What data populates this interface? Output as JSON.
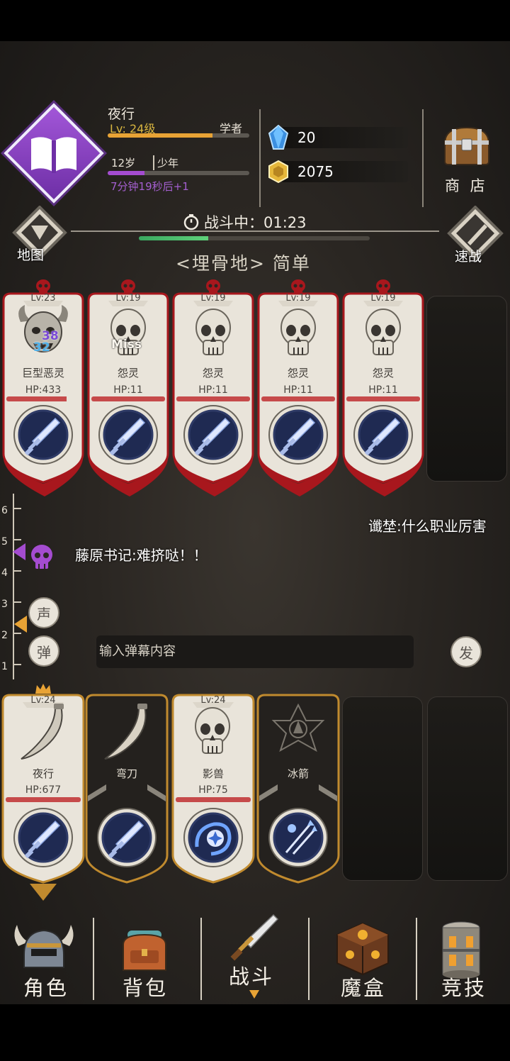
{
  "character": {
    "name": "夜行",
    "level": "Lv: 24级",
    "job": "学者",
    "xp_progress": 0.74,
    "age": "12岁",
    "stage": "少年",
    "age_progress": 0.26,
    "age_timer": "7分钟19秒后+1",
    "class_icon": "book-icon"
  },
  "currency": {
    "gems": "20",
    "coins": "2075",
    "shop_label": "商 店"
  },
  "header": {
    "map_label": "地图",
    "quick_battle_label": "速战",
    "battle_status": "战斗中：01:23",
    "battle_progress": 0.3,
    "location": "<埋骨地> 简单"
  },
  "enemies": [
    {
      "level": "Lv:23",
      "name": "巨型恶灵",
      "hp": "HP:433",
      "hp_ratio": 0.82,
      "dmg1": "38",
      "dmg2": "32",
      "skill": "sword-icon"
    },
    {
      "level": "Lv:19",
      "name": "怨灵",
      "hp": "HP:11",
      "hp_ratio": 1.0,
      "status": "Miss",
      "skill": "sword-icon"
    },
    {
      "level": "Lv:19",
      "name": "怨灵",
      "hp": "HP:11",
      "hp_ratio": 1.0,
      "skill": "sword-icon"
    },
    {
      "level": "Lv:19",
      "name": "怨灵",
      "hp": "HP:11",
      "hp_ratio": 1.0,
      "skill": "sword-icon"
    },
    {
      "level": "Lv:19",
      "name": "怨灵",
      "hp": "HP:11",
      "hp_ratio": 1.0,
      "skill": "sword-icon"
    }
  ],
  "chat": {
    "scale": [
      "6",
      "5",
      "4",
      "3",
      "2",
      "1"
    ],
    "messages": [
      "谶埜:什么职业厉害",
      "藤原书记:难挤哒！！"
    ],
    "voice_button": "声",
    "danmaku_button": "弹",
    "input_placeholder": "输入弹幕内容",
    "send_button": "发"
  },
  "party": [
    {
      "level": "Lv:24",
      "name": "夜行",
      "hp": "HP:677",
      "hp_ratio": 1.0,
      "skill": "sword-icon"
    },
    {
      "level": "",
      "name": "弯刀",
      "hp": "",
      "skill": "sword-icon"
    },
    {
      "level": "Lv:24",
      "name": "影兽",
      "hp": "HP:75",
      "hp_ratio": 1.0,
      "skill": "shadow-orb-icon"
    },
    {
      "level": "",
      "name": "冰箭",
      "hp": "",
      "skill": "ice-arrow-icon"
    }
  ],
  "nav": {
    "items": [
      "角色",
      "背包",
      "战斗",
      "魔盒",
      "竞技"
    ],
    "active_index": 2
  },
  "colors": {
    "enemy_frame": "#a8171d",
    "party_frame": "#c08a2e",
    "level_text": "#d9b640",
    "timer_text": "#a45fd0",
    "hp_bar": "#c64a4a",
    "battle_bar": "#4cc06c"
  }
}
